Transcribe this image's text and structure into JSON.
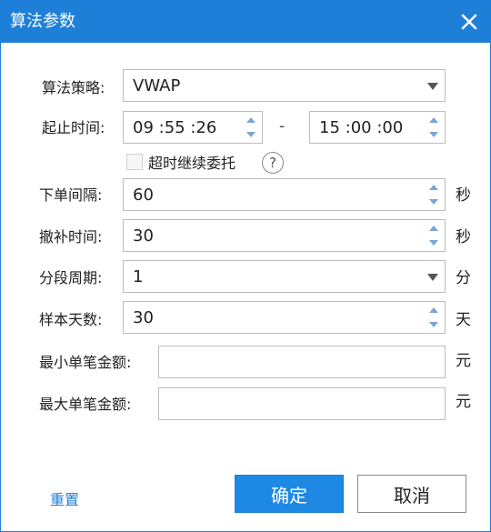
{
  "dialog": {
    "title": "算法参数"
  },
  "form": {
    "algorithm": {
      "label": "算法策略:",
      "value": "VWAP"
    },
    "time_range": {
      "label": "起止时间:",
      "start": "09 :55 :26",
      "separator": "-",
      "end": "15 :00 :00"
    },
    "timeout_continue": {
      "label": "超时继续委托",
      "checked": false,
      "help": "?"
    },
    "order_interval": {
      "label": "下单间隔:",
      "value": "60",
      "unit": "秒"
    },
    "cancel_replenish_time": {
      "label": "撤补时间:",
      "value": "30",
      "unit": "秒"
    },
    "segment_period": {
      "label": "分段周期:",
      "value": "1",
      "unit": "分"
    },
    "sample_days": {
      "label": "样本天数:",
      "value": "30",
      "unit": "天"
    },
    "min_order_amount": {
      "label": "最小单笔金额:",
      "value": "",
      "unit": "元"
    },
    "max_order_amount": {
      "label": "最大单笔金额:",
      "value": "",
      "unit": "元"
    }
  },
  "footer": {
    "reset": "重置",
    "confirm": "确定",
    "cancel": "取消"
  },
  "colors": {
    "accent": "#1e7fd8",
    "primary_button": "#1e88e5",
    "link": "#1e7fd8"
  }
}
